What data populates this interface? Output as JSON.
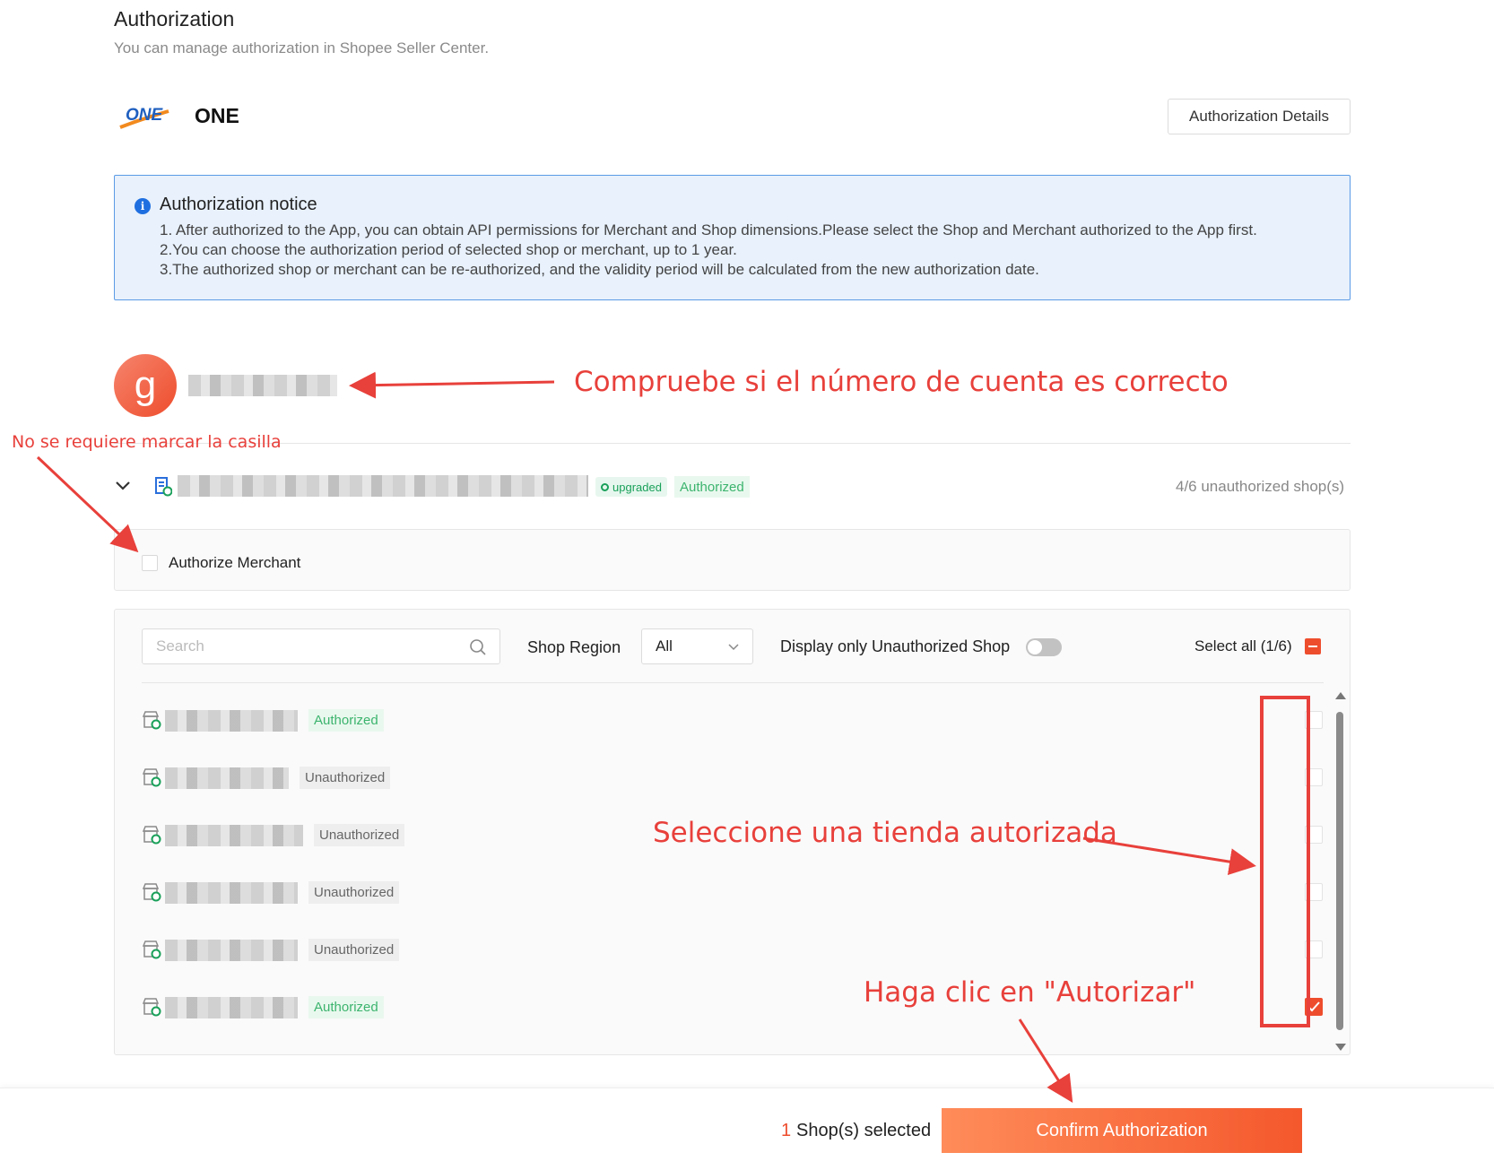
{
  "header": {
    "title": "Authorization",
    "subtitle": "You can manage authorization in Shopee Seller Center."
  },
  "app": {
    "name": "ONE",
    "logo_text": "ONE",
    "details_button": "Authorization Details"
  },
  "notice": {
    "title": "Authorization notice",
    "icon": "info-icon",
    "lines": [
      "1. After authorized to the App, you can obtain API permissions for Merchant and Shop dimensions.Please select the Shop and Merchant authorized to the App first.",
      "2.You can choose the authorization period of selected shop or merchant, up to 1 year.",
      "3.The authorized shop or merchant can be re-authorized, and the validity period will be calculated from the new authorization date."
    ]
  },
  "account": {
    "avatar_letter": "g"
  },
  "merchant": {
    "upgraded_label": "upgraded",
    "status": "Authorized",
    "unauthorized_count": "4/6 unauthorized shop(s)",
    "authorize_label": "Authorize Merchant",
    "authorize_checked": false
  },
  "filters": {
    "search_placeholder": "Search",
    "region_label": "Shop Region",
    "region_value": "All",
    "toggle_label": "Display only Unauthorized Shop",
    "toggle_on": false,
    "select_all_label": "Select all (1/6)"
  },
  "shops": [
    {
      "status": "Authorized",
      "checked": false
    },
    {
      "status": "Unauthorized",
      "checked": false
    },
    {
      "status": "Unauthorized",
      "checked": false
    },
    {
      "status": "Unauthorized",
      "checked": false
    },
    {
      "status": "Unauthorized",
      "checked": false
    },
    {
      "status": "Authorized",
      "checked": true
    }
  ],
  "footer": {
    "selected_count": "1",
    "selected_text": "Shop(s) selected",
    "confirm_label": "Confirm Authorization"
  },
  "annotations": {
    "check_account": "Compruebe si el número de cuenta es correcto",
    "no_check": "No se requiere marcar la casilla",
    "select_shop": "Seleccione una tienda autorizada",
    "click_authorize": "Haga clic en \"Autorizar\""
  },
  "colors": {
    "brand": "#ee4d2d",
    "annotation": "#e8403b",
    "authorized": "#3cb46e",
    "notice_bg": "#e8f1fc",
    "notice_border": "#5b9be6"
  }
}
